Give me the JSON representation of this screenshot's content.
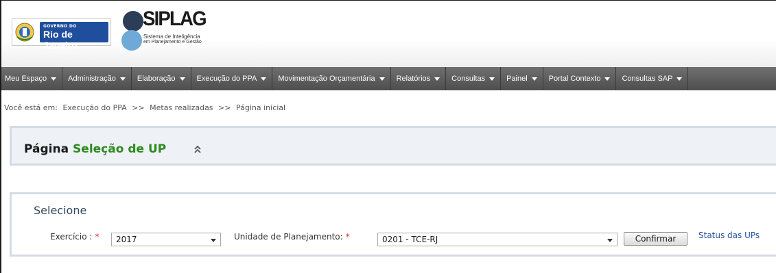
{
  "header": {
    "gov_small": "GOVERNO DO",
    "gov_big": "Rio de Janeiro",
    "app_title": "SIPLAG",
    "app_subtitle_1": "Sistema de Inteligência",
    "app_subtitle_2": "em Planejamento e Gestão"
  },
  "nav": {
    "items": [
      {
        "label": "Meu Espaço"
      },
      {
        "label": "Administração"
      },
      {
        "label": "Elaboração"
      },
      {
        "label": "Execução do PPA"
      },
      {
        "label": "Movimentação Orçamentária"
      },
      {
        "label": "Relatórios"
      },
      {
        "label": "Consultas"
      },
      {
        "label": "Painel"
      },
      {
        "label": "Portal Contexto"
      },
      {
        "label": "Consultas SAP"
      }
    ]
  },
  "breadcrumb": {
    "prefix": "Você está em:",
    "items": [
      "Execução do PPA",
      "Metas realizadas",
      "Página inicial"
    ],
    "separator": ">>"
  },
  "page": {
    "title_prefix": "Página",
    "title_highlight": "Seleção de UP"
  },
  "form": {
    "section_title": "Selecione",
    "exercicio_label": "Exercício :",
    "exercicio_value": "2017",
    "unidade_label": "Unidade de Planejamento:",
    "unidade_value": "0201 - TCE-RJ",
    "required_mark": "*",
    "confirm_label": "Confirmar",
    "status_link": "Status das UPs"
  },
  "colors": {
    "nav_bg": "#5a5a5a",
    "title_green": "#2d8a1e",
    "link_blue": "#1f4e9c",
    "required_red": "#d9302c",
    "panel_bg": "#eef1f5"
  },
  "icons": {
    "collapse": "double-chevron-up-icon",
    "nav_caret": "caret-down-icon",
    "select_arrow": "select-arrow-icon"
  }
}
